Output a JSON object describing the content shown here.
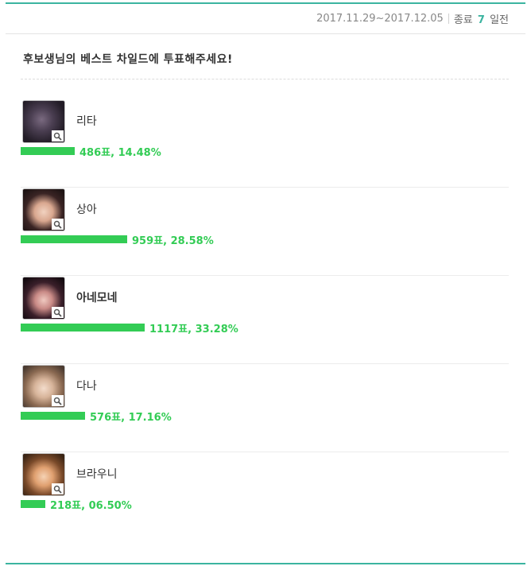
{
  "header": {
    "period": "2017.11.29~2017.12.05",
    "status_label": "종료",
    "days_number": "7",
    "days_suffix": "일전"
  },
  "title": "후보생님의 베스트 차일드에 투표해주세요!",
  "candidates": [
    {
      "name": "리타",
      "votes": "486표",
      "percent": "14.48%",
      "share": 0.1448,
      "highlight": false,
      "icon": "zoom-icon"
    },
    {
      "name": "상아",
      "votes": "959표",
      "percent": "28.58%",
      "share": 0.2858,
      "highlight": false,
      "icon": "zoom-icon"
    },
    {
      "name": "아네모네",
      "votes": "1117표",
      "percent": "33.28%",
      "share": 0.3328,
      "highlight": true,
      "icon": "zoom-icon"
    },
    {
      "name": "다나",
      "votes": "576표",
      "percent": "17.16%",
      "share": 0.1716,
      "highlight": false,
      "icon": "zoom-icon"
    },
    {
      "name": "브라우니",
      "votes": "218표",
      "percent": "06.50%",
      "share": 0.065,
      "highlight": false,
      "icon": "zoom-icon"
    }
  ],
  "colors": {
    "accent": "#3cb4a0",
    "bar": "#33cc55",
    "text": "#333333"
  }
}
